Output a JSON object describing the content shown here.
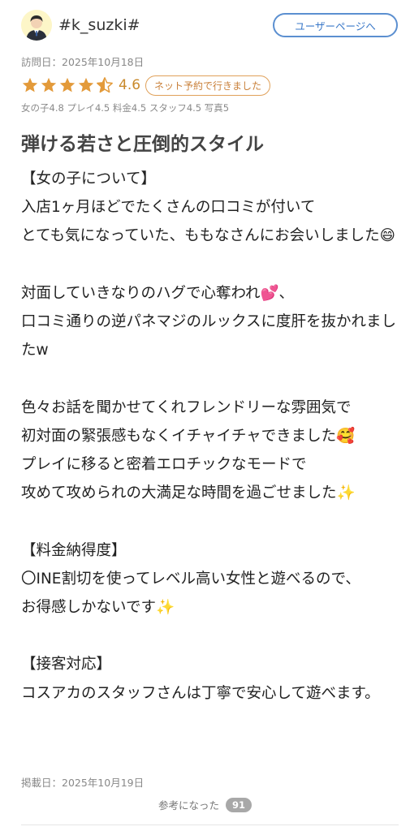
{
  "user": {
    "name": "#k_suzki#",
    "avatar_icon": "person-avatar-icon",
    "user_page_button": "ユーザーページへ"
  },
  "visit_date": "訪問日：2025年10月18日",
  "rating": {
    "stars_filled": 4,
    "stars_half": 1,
    "value": "4.6",
    "star_color": "#e39a3a",
    "badge": "ネット予約で行きました"
  },
  "sub_scores": "女の子4.8 プレイ4.5 料金4.5 スタッフ4.5 写真5",
  "review": {
    "title": "弾ける若さと圧倒的スタイル",
    "body": "【女の子について】\n入店1ヶ月ほどでたくさんの口コミが付いて\nとても気になっていた、ももなさんにお会いしました😄\n\n対面していきなりのハグで心奪われ💕、\n口コミ通りの逆パネマジのルックスに度肝を抜かれましたw\n\n色々お話を聞かせてくれフレンドリーな雰囲気で\n初対面の緊張感もなくイチャイチャできました🥰\nプレイに移ると密着エロチックなモードで\n攻めて攻められの大満足な時間を過ごせました✨\n\n【料金納得度】\n〇INE割切を使ってレベル高い女性と遊べるので、\nお得感しかないです✨\n\n【接客対応】\nコスアカのスタッフさんは丁寧で安心して遊べます。"
  },
  "posted_date": "掲載日：2025年10月19日",
  "helpful": {
    "label": "参考になった",
    "count": "91"
  }
}
